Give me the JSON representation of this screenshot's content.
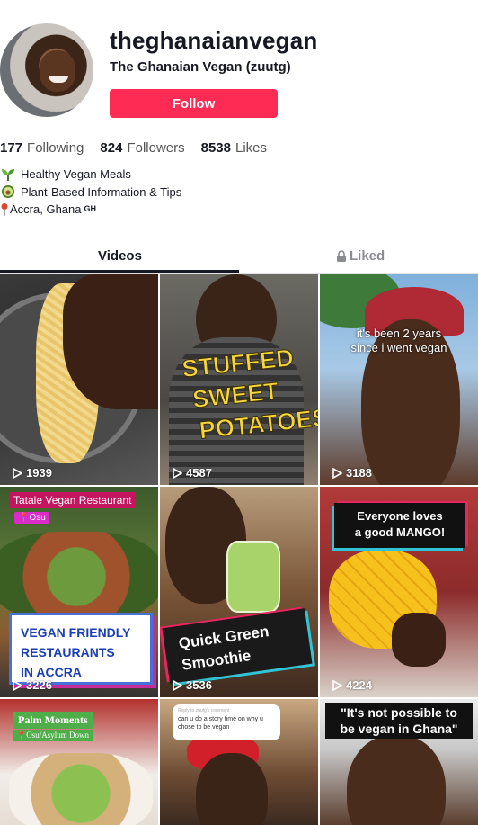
{
  "profile": {
    "username": "theghanaianvegan",
    "nickname": "The Ghanaian Vegan (zuutg)",
    "follow_label": "Follow"
  },
  "stats": {
    "following_count": "177",
    "following_label": "Following",
    "followers_count": "824",
    "followers_label": "Followers",
    "likes_count": "8538",
    "likes_label": "Likes"
  },
  "bio": {
    "line1": "Healthy Vegan Meals",
    "line2": "Plant-Based Information & Tips",
    "line3": "Accra, Ghana",
    "line3_suffix": "GH"
  },
  "tabs": {
    "videos": "Videos",
    "liked": "Liked"
  },
  "colors": {
    "follow_button": "#fe2c55",
    "text": "#161823",
    "muted": "#8a8b91"
  },
  "videos": [
    {
      "views": "1939",
      "overlay": ""
    },
    {
      "views": "4587",
      "overlay_lines": [
        "STUFFED",
        "SWEET",
        "POTATOES"
      ]
    },
    {
      "views": "3188",
      "overlay_lines": [
        "it's been 2 years",
        "since i went vegan"
      ]
    },
    {
      "views": "3226",
      "tag": "Tatale Vegan Restaurant",
      "location": "Osu",
      "overlay_lines": [
        "VEGAN FRIENDLY",
        "RESTAURANTS",
        "IN ACCRA"
      ]
    },
    {
      "views": "3536",
      "overlay_lines": [
        "Quick Green",
        "Smoothie"
      ]
    },
    {
      "views": "4224",
      "overlay_lines": [
        "Everyone loves",
        "a good MANGO!"
      ]
    },
    {
      "views": "",
      "tag": "Palm Moments",
      "location": "Osu/Asylum Down"
    },
    {
      "views": "",
      "reply_header": "Reply to zuutg's comment",
      "reply_text": "can u do a story time on why u chose to be vegan"
    },
    {
      "views": "",
      "overlay_lines": [
        "\"It's not possible to",
        "be vegan in Ghana\""
      ]
    }
  ]
}
